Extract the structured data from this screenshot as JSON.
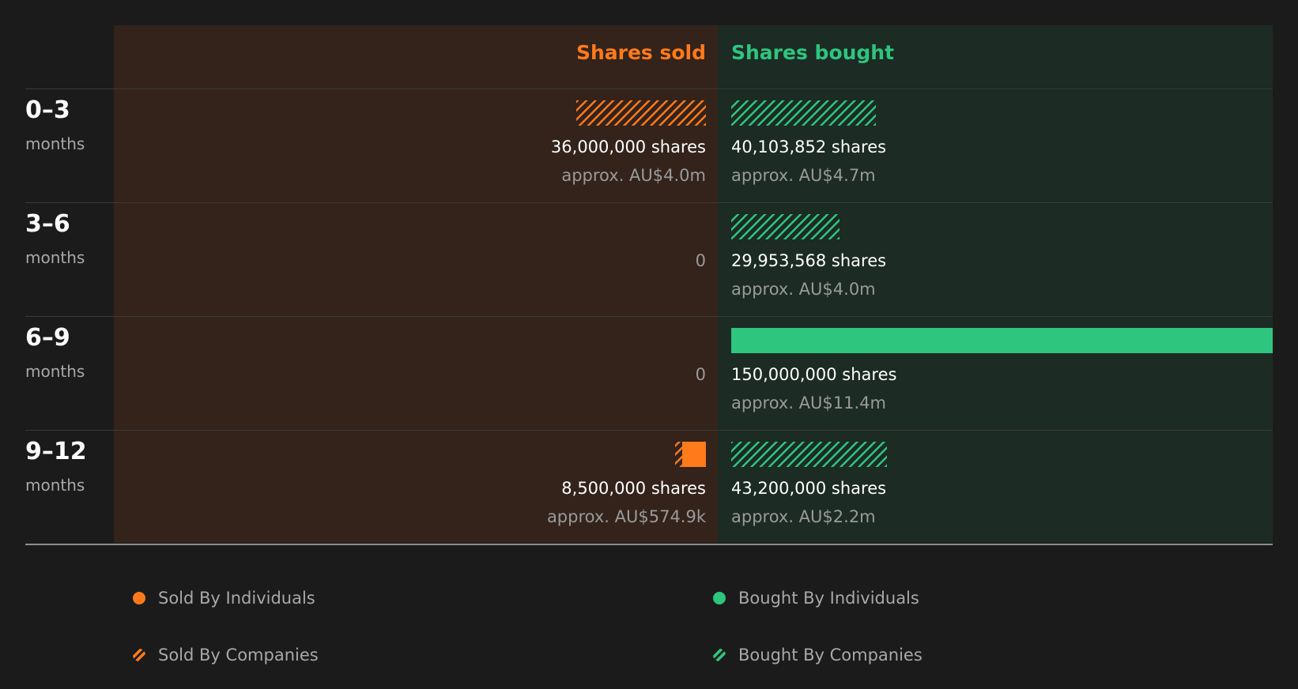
{
  "colors": {
    "sold": "#ff7a1a",
    "bought": "#2ec57e",
    "sold_bg": "#33231b",
    "bought_bg": "#1c2b24"
  },
  "chart_data": {
    "type": "bar",
    "orientation": "horizontal-diverging",
    "headers": {
      "sold": "Shares sold",
      "bought": "Shares bought"
    },
    "categories": [
      {
        "period": "0-3",
        "unit": "months"
      },
      {
        "period": "3-6",
        "unit": "months"
      },
      {
        "period": "6-9",
        "unit": "months"
      },
      {
        "period": "9-12",
        "unit": "months"
      }
    ],
    "series": [
      {
        "name": "Sold By Individuals",
        "side": "sold",
        "style": "solid",
        "values": [
          0,
          0,
          0,
          6500000
        ]
      },
      {
        "name": "Sold By Companies",
        "side": "sold",
        "style": "hatched",
        "values": [
          36000000,
          0,
          0,
          2000000
        ]
      },
      {
        "name": "Bought By Individuals",
        "side": "bought",
        "style": "solid",
        "values": [
          0,
          0,
          150000000,
          0
        ]
      },
      {
        "name": "Bought By Companies",
        "side": "bought",
        "style": "hatched",
        "values": [
          40103852,
          29953568,
          0,
          43200000
        ]
      }
    ],
    "sold_labels": [
      {
        "shares": "36,000,000 shares",
        "approx": "approx. AU$4.0m"
      },
      {
        "zero": "0"
      },
      {
        "zero": "0"
      },
      {
        "shares": "8,500,000 shares",
        "approx": "approx. AU$574.9k"
      }
    ],
    "bought_labels": [
      {
        "shares": "40,103,852 shares",
        "approx": "approx. AU$4.7m"
      },
      {
        "shares": "29,953,568 shares",
        "approx": "approx. AU$4.0m"
      },
      {
        "shares": "150,000,000 shares",
        "approx": "approx. AU$11.4m"
      },
      {
        "shares": "43,200,000 shares",
        "approx": "approx. AU$2.2m"
      }
    ],
    "scale_max": 150000000,
    "legend": [
      {
        "label": "Sold By Individuals",
        "side": "sold",
        "style": "solid"
      },
      {
        "label": "Bought By Individuals",
        "side": "bought",
        "style": "solid"
      },
      {
        "label": "Sold By Companies",
        "side": "sold",
        "style": "hatched"
      },
      {
        "label": "Bought By Companies",
        "side": "bought",
        "style": "hatched"
      }
    ],
    "legend_placement": "bottom"
  }
}
